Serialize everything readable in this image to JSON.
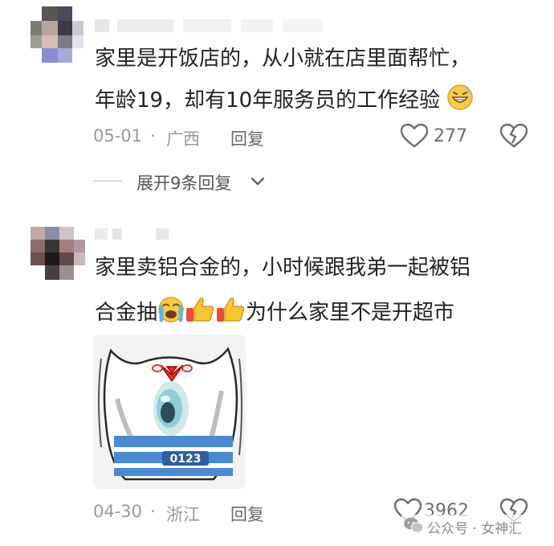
{
  "comments": [
    {
      "avatar_icon": "pixelated-avatar-icon",
      "username": "",
      "text_line1": "家里是开饭店的，从小就在店里面帮忙，",
      "text_line2": "年龄19，却有10年服务员的工作经验",
      "emoji": "grinning-sweat-icon",
      "date": "05-01",
      "dot": "·",
      "location": "广西",
      "reply_label": "回复",
      "like_count": "277",
      "expand_label": "展开9条回复"
    },
    {
      "avatar_icon": "pixelated-avatar-icon",
      "username": "",
      "text_line1": "家里卖铝合金的，小时候跟我弟一起被铝",
      "text_line2_pre": "合金抽",
      "text_line2_post": "为什么家里不是开超市",
      "emojis": [
        "crying-face-icon",
        "thumbs-up-icon",
        "thumbs-up-icon"
      ],
      "meme_image": "cat-meme-image",
      "meme_text": "0123",
      "date": "04-30",
      "dot": "·",
      "location": "浙江",
      "reply_label": "回复",
      "like_count": "3962"
    }
  ],
  "watermark": {
    "icon": "wechat-official-account-icon",
    "text": "公众号 · 女神汇"
  },
  "colors": {
    "text": "#222222",
    "meta": "#9a9a9a",
    "reply": "#6a6a6a",
    "icon_stroke": "#6e6e6e"
  }
}
